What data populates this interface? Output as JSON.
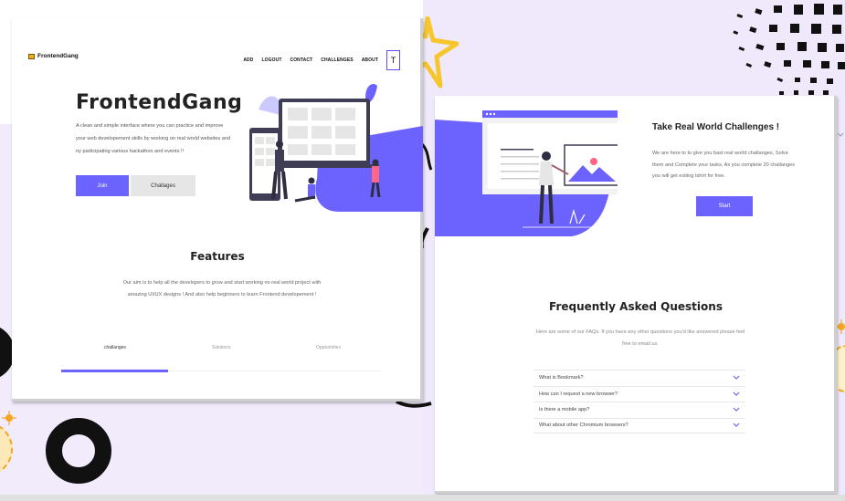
{
  "brand": "FrontendGang",
  "nav": {
    "links": [
      "ADD",
      "LOGOUT",
      "CONTACT",
      "CHALLENGES",
      "ABOUT"
    ],
    "button": "T"
  },
  "hero": {
    "title": "FrontendGang",
    "description": "A clean and simple interface where you can practice and improve your web developement skills by working on real world websites and ny participating various hackathon and events !!",
    "join_label": "Join",
    "challenges_label": "Challages"
  },
  "features": {
    "title": "Features",
    "description": "Our aim is to help all the developers to grow and start working on real world project with amazing UI/UX designs ! And also help beginners to learn Frontend developement !"
  },
  "tabs": [
    "challanges",
    "Solutions",
    "Oppturnities"
  ],
  "challenges_section": {
    "title": "Take Real World Challenges !",
    "description": "We are here to to give you bast real world challanges, Solve them and Complete your tasks, As you complete 20 challanges you will get exiting tshirt for free.",
    "start_label": "Start"
  },
  "faq": {
    "title": "Frequently Asked Questions",
    "description": "Here are some of our FAQs. If you have any other questions you'd like answered please feel free to email us.",
    "items": [
      "What is Bookmark?",
      "How can I request a new browser?",
      "Is there a mobile app?",
      "What about other Chromium browsers?"
    ]
  },
  "colors": {
    "accent": "#6c63ff",
    "star": "#f7c62f",
    "dark": "#111111",
    "background": "#efe9fb"
  }
}
